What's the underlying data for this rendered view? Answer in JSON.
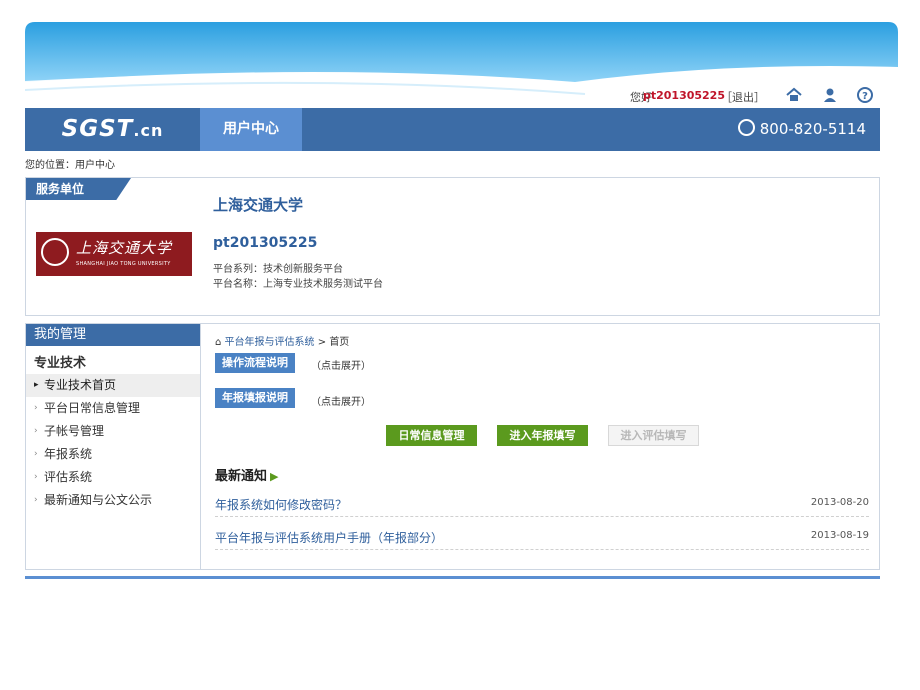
{
  "topbar": {
    "greeting": "您好",
    "username": "pt201305225",
    "logout": "［退出］",
    "icons": [
      "home-icon",
      "user-icon",
      "help-icon"
    ]
  },
  "header": {
    "logo": "SGST",
    "logo_suffix": ".cn",
    "nav_tab": "用户中心",
    "phone": "800-820-5114",
    "brand_color": "#3c6ca6"
  },
  "breadcrumb": "您的位置：用户中心",
  "service": {
    "tag": "服务单位",
    "org_name": "上海交通大学",
    "logo_cn": "上海交通大学",
    "logo_en": "SHANGHAI JIAO TONG UNIVERSITY",
    "user_id": "pt201305225",
    "platform_series": "平台系列：技术创新服务平台",
    "platform_name": "平台名称：上海专业技术服务测试平台"
  },
  "sidebar": {
    "header": "我的管理",
    "section": "专业技术",
    "items": [
      {
        "label": "专业技术首页"
      },
      {
        "label": "平台日常信息管理"
      },
      {
        "label": "子帐号管理"
      },
      {
        "label": "年报系统"
      },
      {
        "label": "评估系统"
      },
      {
        "label": "最新通知与公文公示"
      }
    ]
  },
  "main": {
    "bc_link": "平台年报与评估系统",
    "bc_sep": ">",
    "bc_current": "首页",
    "btn_process": "操作流程说明",
    "btn_annual": "年报填报说明",
    "expand_hint": "（点击展开）",
    "btn_daily": "日常信息管理",
    "btn_enter_annual": "进入年报填写",
    "btn_enter_eval": "进入评估填写",
    "news_title": "最新通知",
    "news": [
      {
        "title": "年报系统如何修改密码？",
        "date": "2013-08-20"
      },
      {
        "title": "平台年报与评估系统用户手册（年报部分）",
        "date": "2013-08-19"
      }
    ]
  }
}
